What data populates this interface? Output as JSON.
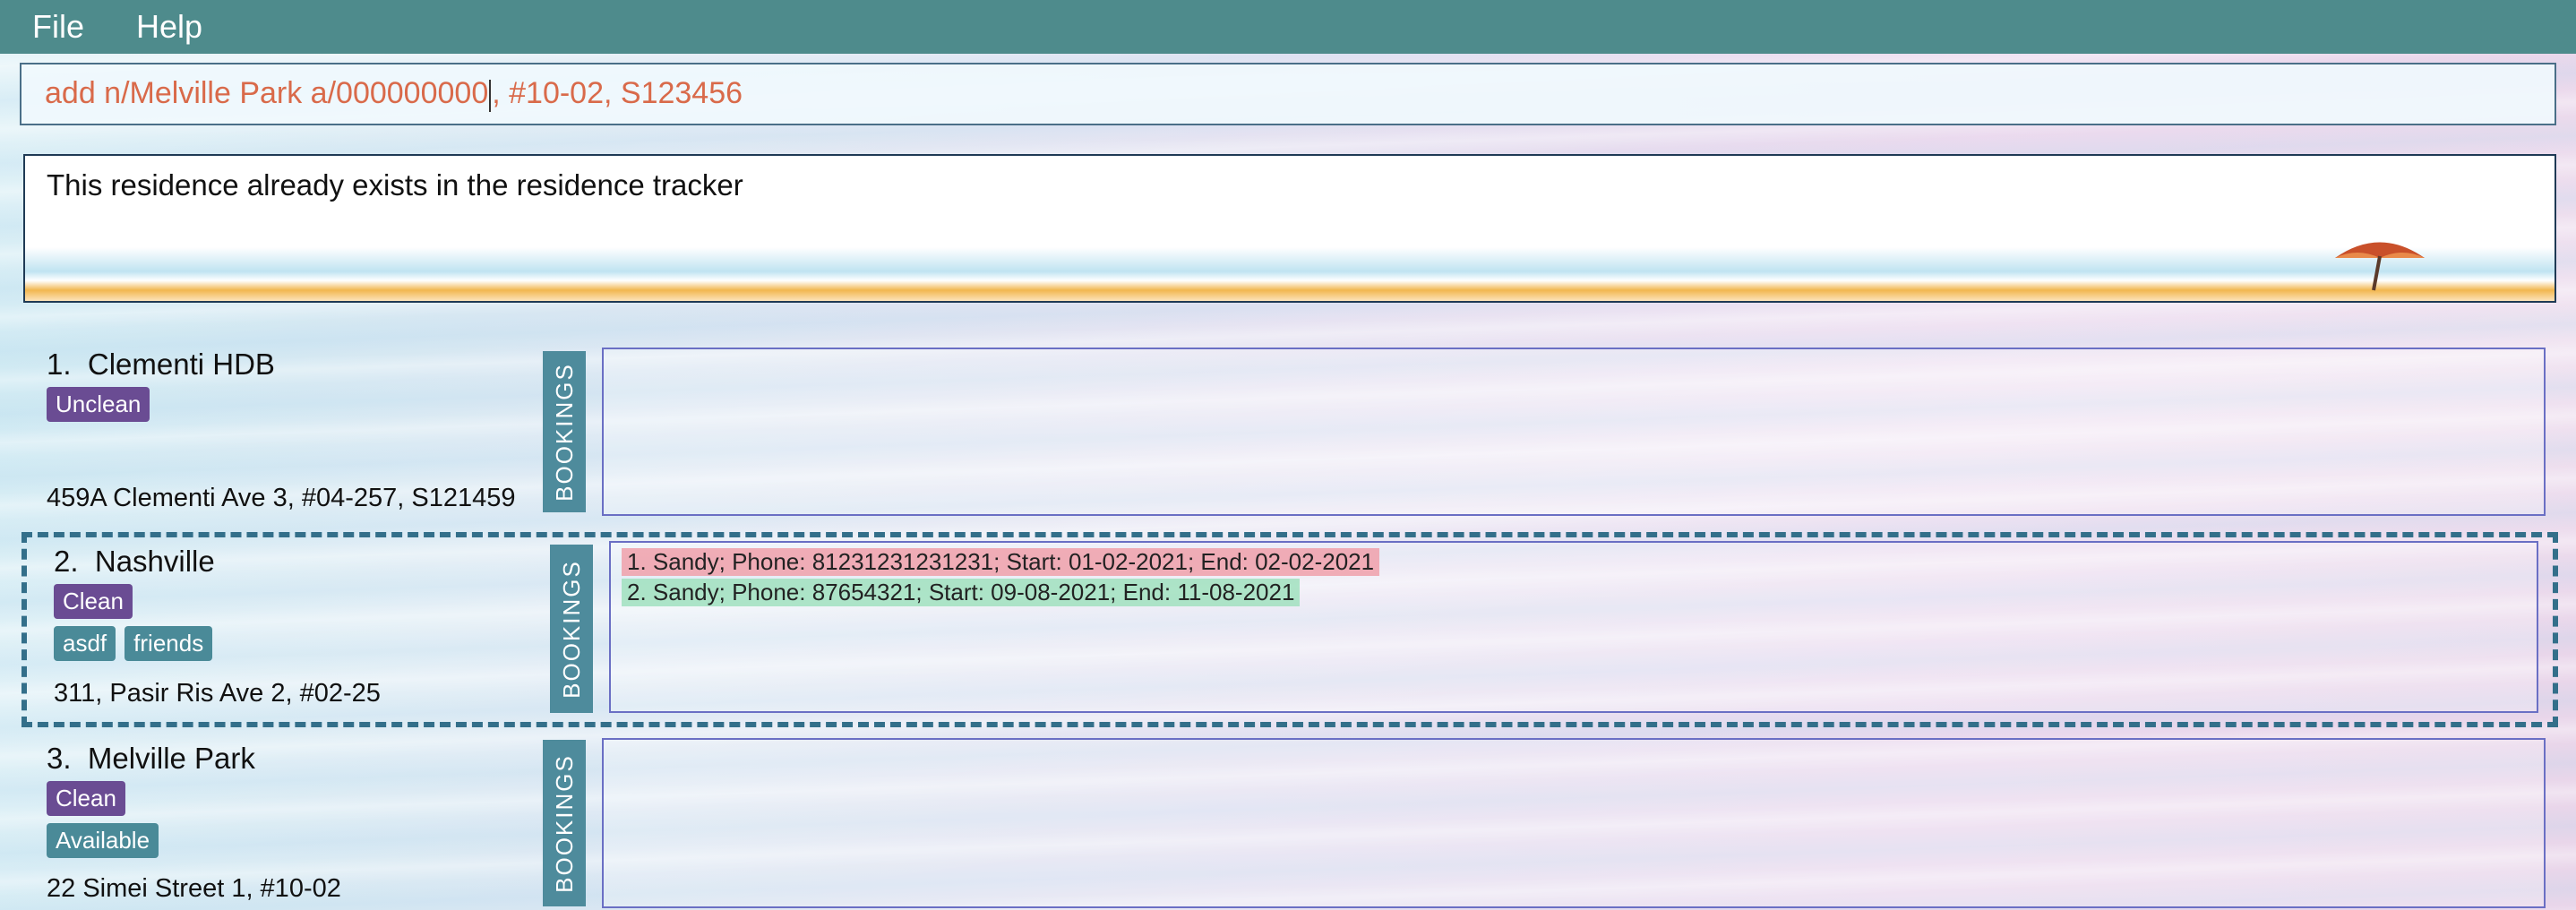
{
  "menu": {
    "file": "File",
    "help": "Help"
  },
  "command": {
    "value_before_caret": "add n/Melville Park a/000000000",
    "value_after_caret": ", #10-02, S123456"
  },
  "result": {
    "message": "This residence already exists in the residence tracker"
  },
  "residences": [
    {
      "title": "1.  Clementi HDB",
      "status": "Unclean",
      "tags": [],
      "address": "459A Clementi Ave 3, #04-257, S121459",
      "bookings_label": "BOOKINGS",
      "bookings": []
    },
    {
      "title": "2.  Nashville",
      "status": "Clean",
      "tags": [
        "asdf",
        "friends"
      ],
      "address": "311, Pasir Ris Ave 2, #02-25",
      "bookings_label": "BOOKINGS",
      "bookings": [
        "1. Sandy; Phone: 81231231231231; Start: 01-02-2021; End: 02-02-2021",
        "2. Sandy; Phone: 87654321; Start: 09-08-2021; End: 11-08-2021"
      ]
    },
    {
      "title": "3.  Melville Park",
      "status": "Clean",
      "tags": [
        "Available"
      ],
      "address": "22 Simei Street 1, #10-02",
      "bookings_label": "BOOKINGS",
      "bookings": []
    }
  ]
}
